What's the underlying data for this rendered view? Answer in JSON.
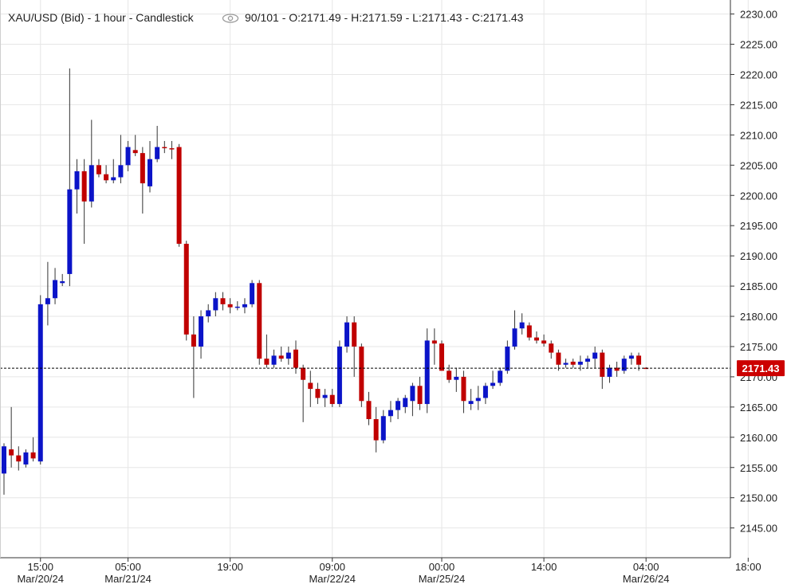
{
  "header": {
    "symbol": "XAU/USD (Bid) - 1 hour - Candlestick",
    "info": "90/101 - O:2171.49 - H:2171.59 - L:2171.43 - C:2171.43"
  },
  "colors": {
    "up": "#0b14c8",
    "down": "#c00000",
    "grid": "#e6e6e6",
    "axis": "#333333",
    "price_label_bg": "#cc0000"
  },
  "chart_data": {
    "type": "candlestick",
    "symbol": "XAU/USD (Bid)",
    "interval": "1 hour",
    "title": "XAU/USD (Bid) - 1 hour - Candlestick",
    "ylim": [
      2141,
      2231
    ],
    "y_ticks": [
      2145,
      2150,
      2155,
      2160,
      2165,
      2170,
      2175,
      2180,
      2185,
      2190,
      2195,
      2200,
      2205,
      2210,
      2215,
      2220,
      2225,
      2230
    ],
    "y_tick_labels": [
      "2145.00",
      "2150.00",
      "2155.00",
      "2160.00",
      "2165.00",
      "2170.00",
      "2175.00",
      "2180.00",
      "2185.00",
      "2190.00",
      "2195.00",
      "2200.00",
      "2205.00",
      "2210.00",
      "2215.00",
      "2220.00",
      "2225.00",
      "2230.00"
    ],
    "x_ticks": [
      {
        "index": 5,
        "label": "15:00",
        "sublabel": "Mar/20/24"
      },
      {
        "index": 17,
        "label": "05:00",
        "sublabel": "Mar/21/24"
      },
      {
        "index": 31,
        "label": "19:00",
        "sublabel": ""
      },
      {
        "index": 45,
        "label": "09:00",
        "sublabel": "Mar/22/24"
      },
      {
        "index": 60,
        "label": "00:00",
        "sublabel": "Mar/25/24"
      },
      {
        "index": 74,
        "label": "14:00",
        "sublabel": ""
      },
      {
        "index": 88,
        "label": "04:00",
        "sublabel": "Mar/26/24"
      },
      {
        "index": 102,
        "label": "18:00",
        "sublabel": ""
      }
    ],
    "last_price": 2171.43,
    "last_price_label": "2171.43",
    "grid": true,
    "candles": [
      {
        "o": 2154.0,
        "h": 2159.0,
        "l": 2150.5,
        "c": 2158.5
      },
      {
        "o": 2158.0,
        "h": 2165.0,
        "l": 2155.0,
        "c": 2157.0
      },
      {
        "o": 2157.0,
        "h": 2158.5,
        "l": 2154.5,
        "c": 2156.0
      },
      {
        "o": 2155.5,
        "h": 2158.0,
        "l": 2155.0,
        "c": 2157.5
      },
      {
        "o": 2157.5,
        "h": 2160.0,
        "l": 2156.0,
        "c": 2156.5
      },
      {
        "o": 2156.0,
        "h": 2183.5,
        "l": 2155.5,
        "c": 2182.0
      },
      {
        "o": 2182.0,
        "h": 2189.0,
        "l": 2178.5,
        "c": 2183.0
      },
      {
        "o": 2183.0,
        "h": 2188.0,
        "l": 2182.0,
        "c": 2186.0
      },
      {
        "o": 2185.5,
        "h": 2187.0,
        "l": 2185.0,
        "c": 2185.8
      },
      {
        "o": 2187.0,
        "h": 2221.0,
        "l": 2185.0,
        "c": 2201.0
      },
      {
        "o": 2201.0,
        "h": 2206.0,
        "l": 2197.0,
        "c": 2204.0
      },
      {
        "o": 2204.0,
        "h": 2206.0,
        "l": 2192.0,
        "c": 2199.0
      },
      {
        "o": 2199.0,
        "h": 2212.5,
        "l": 2198.0,
        "c": 2205.0
      },
      {
        "o": 2205.0,
        "h": 2206.0,
        "l": 2203.0,
        "c": 2203.5
      },
      {
        "o": 2203.5,
        "h": 2205.0,
        "l": 2202.0,
        "c": 2202.5
      },
      {
        "o": 2202.5,
        "h": 2206.0,
        "l": 2202.0,
        "c": 2203.0
      },
      {
        "o": 2203.0,
        "h": 2210.0,
        "l": 2202.0,
        "c": 2205.0
      },
      {
        "o": 2205.0,
        "h": 2209.0,
        "l": 2204.0,
        "c": 2208.0
      },
      {
        "o": 2207.5,
        "h": 2210.0,
        "l": 2206.5,
        "c": 2207.0
      },
      {
        "o": 2207.0,
        "h": 2208.0,
        "l": 2197.0,
        "c": 2202.0
      },
      {
        "o": 2201.5,
        "h": 2209.0,
        "l": 2200.5,
        "c": 2206.0
      },
      {
        "o": 2206.0,
        "h": 2211.5,
        "l": 2205.5,
        "c": 2208.0
      },
      {
        "o": 2208.0,
        "h": 2209.0,
        "l": 2207.0,
        "c": 2207.9
      },
      {
        "o": 2207.8,
        "h": 2209.0,
        "l": 2206.0,
        "c": 2207.7
      },
      {
        "o": 2208.0,
        "h": 2208.5,
        "l": 2191.5,
        "c": 2192.0
      },
      {
        "o": 2192.0,
        "h": 2192.5,
        "l": 2176.0,
        "c": 2177.0
      },
      {
        "o": 2177.0,
        "h": 2180.0,
        "l": 2166.5,
        "c": 2175.0
      },
      {
        "o": 2175.0,
        "h": 2181.0,
        "l": 2173.0,
        "c": 2180.0
      },
      {
        "o": 2180.0,
        "h": 2182.0,
        "l": 2179.0,
        "c": 2181.0
      },
      {
        "o": 2181.0,
        "h": 2184.0,
        "l": 2180.0,
        "c": 2183.0
      },
      {
        "o": 2183.0,
        "h": 2184.0,
        "l": 2181.0,
        "c": 2182.0
      },
      {
        "o": 2182.0,
        "h": 2183.0,
        "l": 2180.5,
        "c": 2181.5
      },
      {
        "o": 2181.5,
        "h": 2182.5,
        "l": 2181.0,
        "c": 2181.6
      },
      {
        "o": 2181.5,
        "h": 2183.0,
        "l": 2180.5,
        "c": 2182.0
      },
      {
        "o": 2182.0,
        "h": 2186.0,
        "l": 2181.5,
        "c": 2185.5
      },
      {
        "o": 2185.5,
        "h": 2186.0,
        "l": 2172.0,
        "c": 2173.0
      },
      {
        "o": 2173.0,
        "h": 2177.0,
        "l": 2171.5,
        "c": 2172.0
      },
      {
        "o": 2172.0,
        "h": 2174.5,
        "l": 2171.5,
        "c": 2173.5
      },
      {
        "o": 2173.5,
        "h": 2175.0,
        "l": 2172.5,
        "c": 2173.0
      },
      {
        "o": 2173.0,
        "h": 2175.0,
        "l": 2172.0,
        "c": 2174.0
      },
      {
        "o": 2174.5,
        "h": 2176.0,
        "l": 2170.5,
        "c": 2171.5
      },
      {
        "o": 2171.5,
        "h": 2172.0,
        "l": 2162.5,
        "c": 2169.5
      },
      {
        "o": 2169.0,
        "h": 2171.0,
        "l": 2165.0,
        "c": 2168.0
      },
      {
        "o": 2168.0,
        "h": 2169.0,
        "l": 2165.5,
        "c": 2166.5
      },
      {
        "o": 2166.5,
        "h": 2168.0,
        "l": 2165.0,
        "c": 2167.0
      },
      {
        "o": 2167.0,
        "h": 2168.0,
        "l": 2165.0,
        "c": 2165.5
      },
      {
        "o": 2165.5,
        "h": 2176.0,
        "l": 2165.0,
        "c": 2175.0
      },
      {
        "o": 2175.0,
        "h": 2180.0,
        "l": 2174.0,
        "c": 2179.0
      },
      {
        "o": 2179.0,
        "h": 2180.0,
        "l": 2170.0,
        "c": 2175.0
      },
      {
        "o": 2175.0,
        "h": 2175.5,
        "l": 2165.0,
        "c": 2166.0
      },
      {
        "o": 2166.0,
        "h": 2167.5,
        "l": 2162.0,
        "c": 2163.0
      },
      {
        "o": 2163.0,
        "h": 2165.0,
        "l": 2157.5,
        "c": 2159.5
      },
      {
        "o": 2159.5,
        "h": 2164.5,
        "l": 2159.0,
        "c": 2163.5
      },
      {
        "o": 2163.5,
        "h": 2166.0,
        "l": 2162.5,
        "c": 2164.5
      },
      {
        "o": 2164.5,
        "h": 2166.5,
        "l": 2163.0,
        "c": 2166.0
      },
      {
        "o": 2165.0,
        "h": 2167.0,
        "l": 2164.0,
        "c": 2166.5
      },
      {
        "o": 2166.0,
        "h": 2169.0,
        "l": 2163.5,
        "c": 2168.5
      },
      {
        "o": 2168.5,
        "h": 2170.0,
        "l": 2164.5,
        "c": 2165.5
      },
      {
        "o": 2165.5,
        "h": 2178.0,
        "l": 2164.0,
        "c": 2176.0
      },
      {
        "o": 2176.0,
        "h": 2178.0,
        "l": 2172.0,
        "c": 2175.5
      },
      {
        "o": 2175.5,
        "h": 2176.0,
        "l": 2171.0,
        "c": 2171.0
      },
      {
        "o": 2171.0,
        "h": 2172.0,
        "l": 2169.0,
        "c": 2169.5
      },
      {
        "o": 2169.5,
        "h": 2171.5,
        "l": 2167.5,
        "c": 2170.0
      },
      {
        "o": 2170.0,
        "h": 2171.0,
        "l": 2164.0,
        "c": 2166.0
      },
      {
        "o": 2165.5,
        "h": 2168.0,
        "l": 2164.5,
        "c": 2166.0
      },
      {
        "o": 2166.0,
        "h": 2168.5,
        "l": 2164.5,
        "c": 2166.5
      },
      {
        "o": 2166.5,
        "h": 2169.0,
        "l": 2165.5,
        "c": 2168.5
      },
      {
        "o": 2168.5,
        "h": 2171.0,
        "l": 2168.0,
        "c": 2169.0
      },
      {
        "o": 2169.0,
        "h": 2171.5,
        "l": 2168.5,
        "c": 2171.0
      },
      {
        "o": 2171.0,
        "h": 2176.0,
        "l": 2170.5,
        "c": 2175.0
      },
      {
        "o": 2175.0,
        "h": 2181.0,
        "l": 2174.5,
        "c": 2178.0
      },
      {
        "o": 2178.0,
        "h": 2180.5,
        "l": 2177.0,
        "c": 2179.0
      },
      {
        "o": 2178.5,
        "h": 2179.0,
        "l": 2176.0,
        "c": 2176.5
      },
      {
        "o": 2176.5,
        "h": 2177.5,
        "l": 2175.5,
        "c": 2176.0
      },
      {
        "o": 2176.0,
        "h": 2177.0,
        "l": 2175.0,
        "c": 2175.5
      },
      {
        "o": 2175.5,
        "h": 2176.0,
        "l": 2173.0,
        "c": 2174.0
      },
      {
        "o": 2174.0,
        "h": 2174.5,
        "l": 2171.0,
        "c": 2172.0
      },
      {
        "o": 2172.0,
        "h": 2173.0,
        "l": 2171.5,
        "c": 2172.3
      },
      {
        "o": 2172.5,
        "h": 2173.0,
        "l": 2171.5,
        "c": 2172.0
      },
      {
        "o": 2172.0,
        "h": 2173.5,
        "l": 2171.0,
        "c": 2172.5
      },
      {
        "o": 2172.5,
        "h": 2173.5,
        "l": 2171.5,
        "c": 2173.0
      },
      {
        "o": 2173.0,
        "h": 2175.0,
        "l": 2171.5,
        "c": 2174.0
      },
      {
        "o": 2174.0,
        "h": 2174.5,
        "l": 2168.0,
        "c": 2170.0
      },
      {
        "o": 2170.0,
        "h": 2172.0,
        "l": 2169.0,
        "c": 2171.5
      },
      {
        "o": 2171.5,
        "h": 2172.5,
        "l": 2170.0,
        "c": 2171.0
      },
      {
        "o": 2171.0,
        "h": 2173.5,
        "l": 2170.5,
        "c": 2173.0
      },
      {
        "o": 2173.0,
        "h": 2174.0,
        "l": 2172.0,
        "c": 2173.5
      },
      {
        "o": 2173.5,
        "h": 2174.0,
        "l": 2171.0,
        "c": 2172.0
      },
      {
        "o": 2171.49,
        "h": 2171.59,
        "l": 2171.43,
        "c": 2171.43
      }
    ]
  }
}
